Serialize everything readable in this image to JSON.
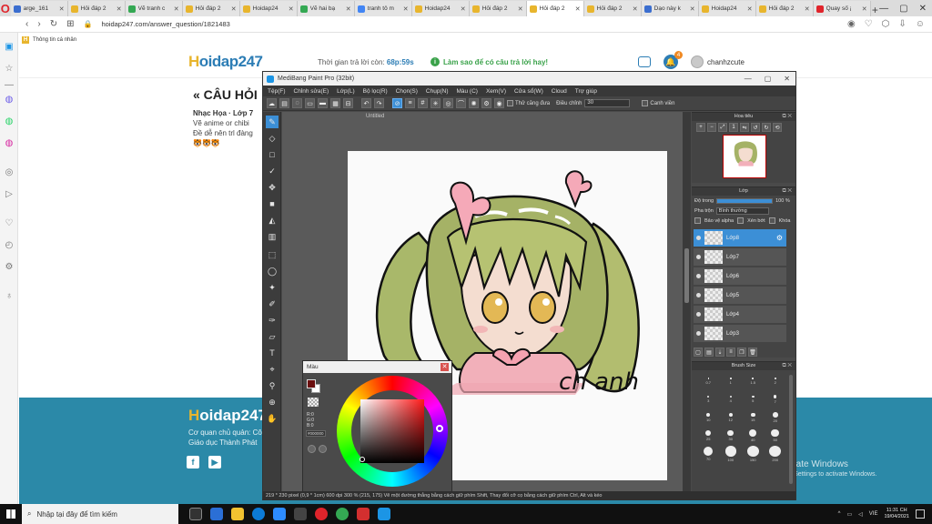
{
  "browser": {
    "tabs": [
      {
        "label": "arge_161",
        "color": "#3b6ecf"
      },
      {
        "label": "Hỏi đáp 2",
        "color": "#e8b52d"
      },
      {
        "label": "Vẽ tranh c",
        "color": "#34a853"
      },
      {
        "label": "Hỏi đáp 2",
        "color": "#e8b52d"
      },
      {
        "label": "Hoidap24",
        "color": "#e8b52d"
      },
      {
        "label": "Vẽ hai bạ",
        "color": "#34a853"
      },
      {
        "label": "tranh tô m",
        "color": "#4285f4"
      },
      {
        "label": "Hoidap24",
        "color": "#e8b52d"
      },
      {
        "label": "Hỏi đáp 2",
        "color": "#e8b52d"
      },
      {
        "label": "Hỏi đáp 2",
        "color": "#e8b52d"
      },
      {
        "label": "Hỏi đáp 2",
        "color": "#e8b52d"
      },
      {
        "label": "Dạo này k",
        "color": "#3b6ecf"
      },
      {
        "label": "Hoidap24",
        "color": "#e8b52d"
      },
      {
        "label": "Hỏi đáp 2",
        "color": "#e8b52d"
      },
      {
        "label": "Quay số ¡",
        "color": "#e0242b"
      }
    ],
    "active_tab_index": 9,
    "new_tab": "+",
    "url": "hoidap247.com/answer_question/1821483",
    "bookmark": "Thông tin cá nhân"
  },
  "site": {
    "logo_h": "H",
    "logo_rest": "oidap247",
    "timer_label": "Thời gian trả lời còn:",
    "timer_value": "68p:59s",
    "tip": "Làm sao để có câu trả lời hay!",
    "notif_count": "4",
    "username": "chanhzcute",
    "question_title": "« CÂU HỎI",
    "question_meta": "Nhạc Họa · Lớp 7",
    "question_line1": "Vẽ anime or chibi",
    "question_line2": "Đề dễ nên trl đàng",
    "question_emoji": "🐯🐯🐯",
    "footer_line1": "Cơ quan chủ quản: Cô",
    "footer_line2": "Giáo dục Thành Phát",
    "social_fb": "f",
    "social_yt": "▶",
    "activate_title": "Activate Windows",
    "activate_sub": "Go to Settings to activate Windows."
  },
  "app": {
    "title": "MediBang Paint Pro (32bit)",
    "menu": [
      "Tệp(F)",
      "Chỉnh sửa(E)",
      "Lớp(L)",
      "Bộ lọc(R)",
      "Chọn(S)",
      "Chụp(N)",
      "Màu (C)",
      "Xem(V)",
      "Cửa sổ(W)",
      "Cloud",
      "Trợ giúp"
    ],
    "toolbar_checkbox": "Thử căng đưa",
    "toolbar_label": "Điều chỉnh",
    "toolbar_value": "30",
    "toolbar_right": "Canh viền",
    "doc_tab": "Untitled",
    "status": "219 * 230 pixel    (0,9 * 1cm)    600 dpi    300 %    (215, 175)    Vẽ một đường thẳng bằng cách giữ phím Shift, Thay đổi cỡ cọ bằng cách giữ phím Ctrl, Alt và kéo",
    "navigator_title": "Hoa tiêu",
    "layer_panel_title": "Lớp",
    "opacity_label": "Độ trong",
    "opacity_value": "100 %",
    "opacity": 1.0,
    "blend_label": "Pha trộn",
    "blend_value": "Bình thường",
    "protect_alpha": "Bảo vệ alpha",
    "clip": "Xén bớt",
    "lock": "Khóa",
    "layers": [
      {
        "name": "Lớp8",
        "selected": true
      },
      {
        "name": "Lớp7",
        "selected": false
      },
      {
        "name": "Lớp6",
        "selected": false
      },
      {
        "name": "Lớp5",
        "selected": false
      },
      {
        "name": "Lớp4",
        "selected": false
      },
      {
        "name": "Lớp3",
        "selected": false
      }
    ],
    "brush_panel_title": "Brush Size",
    "brush_sizes": [
      "0.7",
      "1",
      "1.5",
      "2",
      "3",
      "4",
      "5",
      "7",
      "10",
      "12",
      "15",
      "20",
      "25",
      "30",
      "40",
      "50",
      "70",
      "100",
      "150",
      "200"
    ],
    "signature": "ch anh"
  },
  "color_dialog": {
    "title": "Màu",
    "fg_color": "#6b0f0f",
    "rgb_r": "R:0",
    "rgb_g": "G:0",
    "rgb_b": "B:0",
    "hex": "#000000"
  },
  "taskbar": {
    "search_placeholder": "Nhập tại đây để tìm kiếm",
    "lang": "VIE",
    "time": "11:31 CH",
    "date": "19/04/2021"
  }
}
